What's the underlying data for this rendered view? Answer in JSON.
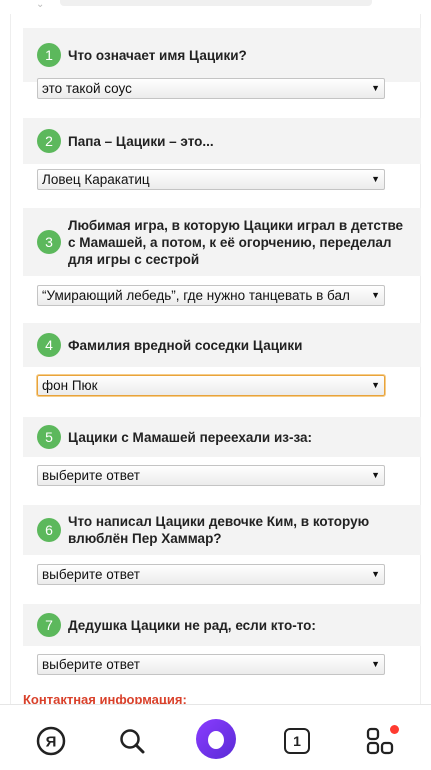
{
  "quiz": {
    "questions": [
      {
        "number": "1",
        "text": "Что означает имя Цацики?",
        "answer": "это такой соус"
      },
      {
        "number": "2",
        "text": "Папа – Цацики – это...",
        "answer": "Ловец Каракатиц"
      },
      {
        "number": "3",
        "text": "Любимая игра, в которую Цацики играл в детстве с Мамашей, а потом, к её огорчению, переделал для игры с сестрой",
        "answer": "“Умирающий лебедь”, где нужно танцевать в бал"
      },
      {
        "number": "4",
        "text": "Фамилия вредной соседки Цацики",
        "answer": "фон Пюк"
      },
      {
        "number": "5",
        "text": "Цацики с Мамашей переехали из-за:",
        "answer": "выберите ответ"
      },
      {
        "number": "6",
        "text": "Что написал Цацики девочке Ким, в которую влюблён Пер Хаммар?",
        "answer": "выберите ответ"
      },
      {
        "number": "7",
        "text": "Дедушка Цацики не рад, если кто-то:",
        "answer": "выберите ответ"
      }
    ]
  },
  "contact": {
    "label": "Контактная информация:"
  },
  "navbar": {
    "yandex_label": "Я",
    "tabs_count": "1",
    "icons": [
      "yandex-icon",
      "search-icon",
      "alice-icon",
      "tabs-icon",
      "services-icon"
    ]
  },
  "colors": {
    "accent_green": "#5cb85c",
    "alice_purple": "#7a35f0",
    "notification_red": "#ff3b30"
  }
}
